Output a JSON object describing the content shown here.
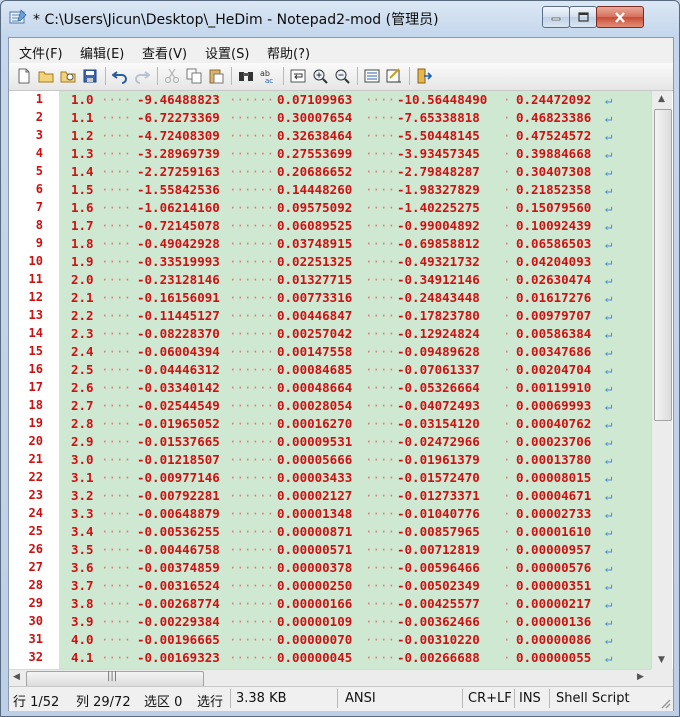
{
  "window": {
    "title": "* C:\\Users\\Jicun\\Desktop\\_HeDim - Notepad2-mod (管理员)",
    "minimize_icon": "minimize-icon",
    "maximize_icon": "maximize-icon",
    "close_icon": "close-icon"
  },
  "menu": [
    "文件(F)",
    "编辑(E)",
    "查看(V)",
    "设置(S)",
    "帮助(?)"
  ],
  "toolbar_icons": [
    "new-icon",
    "open-icon",
    "browse-icon",
    "save-icon",
    "undo-icon",
    "redo-icon",
    "cut-icon",
    "copy-icon",
    "paste-icon",
    "find-icon",
    "replace-icon",
    "wordwrap-icon",
    "zoom-in-icon",
    "zoom-out-icon",
    "schemes-icon",
    "customize-icon",
    "exit-icon"
  ],
  "colors": {
    "text": "#d01010",
    "background": "#cfe8d2",
    "eol": "#4a8ccf"
  },
  "lines": [
    [
      "1",
      "1.0",
      "-9.46488823",
      "0.07109963",
      "-10.56448490",
      "0.24472092"
    ],
    [
      "2",
      "1.1",
      "-6.72273369",
      "0.30007654",
      "-7.65338818",
      "0.46823386"
    ],
    [
      "3",
      "1.2",
      "-4.72408309",
      "0.32638464",
      "-5.50448145",
      "0.47524572"
    ],
    [
      "4",
      "1.3",
      "-3.28969739",
      "0.27553699",
      "-3.93457345",
      "0.39884668"
    ],
    [
      "5",
      "1.4",
      "-2.27259163",
      "0.20686652",
      "-2.79848287",
      "0.30407308"
    ],
    [
      "6",
      "1.5",
      "-1.55842536",
      "0.14448260",
      "-1.98327829",
      "0.21852358"
    ],
    [
      "7",
      "1.6",
      "-1.06214160",
      "0.09575092",
      "-1.40225275",
      "0.15079560"
    ],
    [
      "8",
      "1.7",
      "-0.72145078",
      "0.06089525",
      "-0.99004892",
      "0.10092439"
    ],
    [
      "9",
      "1.8",
      "-0.49042928",
      "0.03748915",
      "-0.69858812",
      "0.06586503"
    ],
    [
      "10",
      "1.9",
      "-0.33519993",
      "0.02251325",
      "-0.49321732",
      "0.04204093"
    ],
    [
      "11",
      "2.0",
      "-0.23128146",
      "0.01327715",
      "-0.34912146",
      "0.02630474"
    ],
    [
      "12",
      "2.1",
      "-0.16156091",
      "0.00773316",
      "-0.24843448",
      "0.01617276"
    ],
    [
      "13",
      "2.2",
      "-0.11445127",
      "0.00446847",
      "-0.17823780",
      "0.00979707"
    ],
    [
      "14",
      "2.3",
      "-0.08228370",
      "0.00257042",
      "-0.12924824",
      "0.00586384"
    ],
    [
      "15",
      "2.4",
      "-0.06004394",
      "0.00147558",
      "-0.09489628",
      "0.00347686"
    ],
    [
      "16",
      "2.5",
      "-0.04446312",
      "0.00084685",
      "-0.07061337",
      "0.00204704"
    ],
    [
      "17",
      "2.6",
      "-0.03340142",
      "0.00048664",
      "-0.05326664",
      "0.00119910"
    ],
    [
      "18",
      "2.7",
      "-0.02544549",
      "0.00028054",
      "-0.04072493",
      "0.00069993"
    ],
    [
      "19",
      "2.8",
      "-0.01965052",
      "0.00016270",
      "-0.03154120",
      "0.00040762"
    ],
    [
      "20",
      "2.9",
      "-0.01537665",
      "0.00009531",
      "-0.02472966",
      "0.00023706"
    ],
    [
      "21",
      "3.0",
      "-0.01218507",
      "0.00005666",
      "-0.01961379",
      "0.00013780"
    ],
    [
      "22",
      "3.1",
      "-0.00977146",
      "0.00003433",
      "-0.01572470",
      "0.00008015"
    ],
    [
      "23",
      "3.2",
      "-0.00792281",
      "0.00002127",
      "-0.01273371",
      "0.00004671"
    ],
    [
      "24",
      "3.3",
      "-0.00648879",
      "0.00001348",
      "-0.01040776",
      "0.00002733"
    ],
    [
      "25",
      "3.4",
      "-0.00536255",
      "0.00000871",
      "-0.00857965",
      "0.00001610"
    ],
    [
      "26",
      "3.5",
      "-0.00446758",
      "0.00000571",
      "-0.00712819",
      "0.00000957"
    ],
    [
      "27",
      "3.6",
      "-0.00374859",
      "0.00000378",
      "-0.00596466",
      "0.00000576"
    ],
    [
      "28",
      "3.7",
      "-0.00316524",
      "0.00000250",
      "-0.00502349",
      "0.00000351"
    ],
    [
      "29",
      "3.8",
      "-0.00268774",
      "0.00000166",
      "-0.00425577",
      "0.00000217"
    ],
    [
      "30",
      "3.9",
      "-0.00229384",
      "0.00000109",
      "-0.00362466",
      "0.00000136"
    ],
    [
      "31",
      "4.0",
      "-0.00196665",
      "0.00000070",
      "-0.00310220",
      "0.00000086"
    ],
    [
      "32",
      "4.1",
      "-0.00169323",
      "0.00000045",
      "-0.00266688",
      "0.00000055"
    ]
  ],
  "eol_glyph": "↵",
  "hscroll_grip": "|||",
  "status": {
    "line": "行 1/52",
    "col": "列 29/72",
    "sel": "选区 0",
    "sel_lines": "选行",
    "size": "3.38 KB",
    "encoding": "ANSI",
    "eol_mode": "CR+LF",
    "ins": "INS",
    "lexer": "Shell Script"
  }
}
